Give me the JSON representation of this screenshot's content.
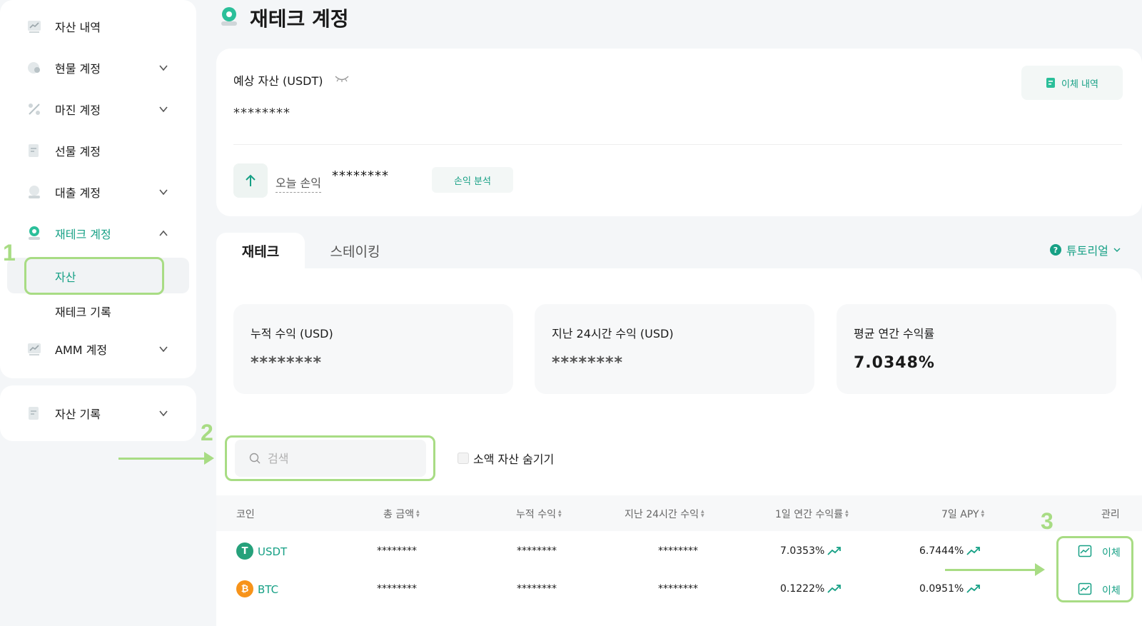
{
  "sidebar": {
    "items": [
      {
        "label": "자산 내역"
      },
      {
        "label": "현물 계정"
      },
      {
        "label": "마진 계정"
      },
      {
        "label": "선물 계정"
      },
      {
        "label": "대출 계정"
      },
      {
        "label": "재테크 계정"
      },
      {
        "label": "AMM 계정"
      }
    ],
    "sub_items": [
      {
        "label": "자산"
      },
      {
        "label": "재테크 기록"
      }
    ],
    "asset_history": "자산 기록"
  },
  "annotations": {
    "n1": "1",
    "n2": "2",
    "n3": "3"
  },
  "page": {
    "title": "재테크 계정"
  },
  "summary": {
    "est_label": "예상 자산 (USDT)",
    "est_value": "********",
    "transfer_history": "이체 내역",
    "today_label": "오늘 손익",
    "today_value": "********",
    "pnl_analysis": "손익 분석"
  },
  "tabs": [
    {
      "label": "재테크"
    },
    {
      "label": "스테이킹"
    }
  ],
  "tutorial": "튜토리얼",
  "stats": [
    {
      "label": "누적 수익 (USD)",
      "value": "********"
    },
    {
      "label": "지난 24시간 수익 (USD)",
      "value": "********"
    },
    {
      "label": "평균 연간 수익률",
      "value": "7.0348%"
    }
  ],
  "search": {
    "placeholder": "검색"
  },
  "hide_small": "소액 자산 숨기기",
  "table": {
    "headers": [
      "코인",
      "총 금액",
      "누적 수익",
      "지난 24시간 수익",
      "1일 연간 수익률",
      "7일 APY",
      "관리"
    ],
    "rows": [
      {
        "coin": "USDT",
        "total": "********",
        "cumulative": "********",
        "last24": "********",
        "apr1d": "7.0353%",
        "apy7d": "6.7444%",
        "action": "이체"
      },
      {
        "coin": "BTC",
        "total": "********",
        "cumulative": "********",
        "last24": "********",
        "apr1d": "0.1222%",
        "apy7d": "0.0951%",
        "action": "이체"
      }
    ]
  },
  "colors": {
    "accent": "#16a085",
    "highlight": "#a8dc84",
    "usdt": "#26a17b",
    "btc": "#f7931a"
  }
}
